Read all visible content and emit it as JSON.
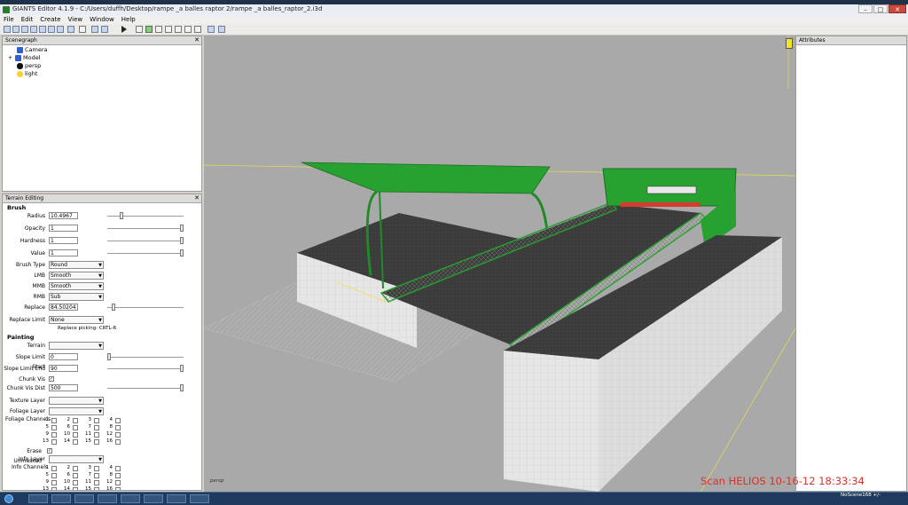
{
  "window": {
    "title": "GIANTS Editor 4.1.9 - C:/Users/duffh/Desktop/rampe _a balles raptor 2/rampe _a balles_raptor_2.i3d",
    "minimize": "–",
    "maximize": "□",
    "close": "✕"
  },
  "menu": [
    "File",
    "Edit",
    "Create",
    "View",
    "Window",
    "Help"
  ],
  "scenegraph": {
    "title": "Scenegraph",
    "close": "✕",
    "items": [
      {
        "label": "Camera",
        "icon": "camera-icon",
        "expand": ""
      },
      {
        "label": "Model",
        "icon": "model-icon",
        "expand": "+"
      },
      {
        "label": "persp",
        "icon": "persp-camera-icon",
        "expand": ""
      },
      {
        "label": "light",
        "icon": "light-bulb-icon",
        "expand": ""
      }
    ]
  },
  "terrain": {
    "title": "Terrain Editing",
    "close": "✕",
    "brush_header": "Brush",
    "radius": {
      "label": "Radius",
      "value": "10.4967",
      "level": 0.17
    },
    "opacity": {
      "label": "Opacity",
      "value": "1",
      "level": 1.0
    },
    "hardness": {
      "label": "Hardness",
      "value": "1",
      "level": 1.0
    },
    "value": {
      "label": "Value",
      "value": "1",
      "level": 1.0
    },
    "brush_type": {
      "label": "Brush Type",
      "value": "Round"
    },
    "lmb": {
      "label": "LMB",
      "value": "Smooth"
    },
    "mmb": {
      "label": "MMB",
      "value": "Smooth"
    },
    "rmb": {
      "label": "RMB",
      "value": "Sub"
    },
    "replace": {
      "label": "Replace",
      "value": "84.50204",
      "level": 0.06
    },
    "replace_limit": {
      "label": "Replace Limit",
      "value": "None"
    },
    "replace_picking": "Replace picking: CRTL-R",
    "painting_header": "Painting",
    "terrain_field": {
      "label": "Terrain",
      "value": ""
    },
    "slope_start": {
      "label": "Slope Limit Start",
      "value": "0",
      "level": 0.0
    },
    "slope_end": {
      "label": "Slope Limit End",
      "value": "90",
      "level": 1.0
    },
    "chunk_vis": {
      "label": "Chunk Vis",
      "check": "✓"
    },
    "chunk_vis_dist": {
      "label": "Chunk Vis Dist",
      "value": "500",
      "level": 1.0
    },
    "texture_layer": {
      "label": "Texture Layer",
      "value": ""
    },
    "foliage_layer": {
      "label": "Foliage Layer",
      "value": ""
    },
    "foliage_channels": {
      "label": "Foliage Channels",
      "numbers": [
        "1",
        "2",
        "3",
        "4",
        "5",
        "6",
        "7",
        "8",
        "9",
        "10",
        "11",
        "12",
        "13",
        "14",
        "15",
        "16"
      ]
    },
    "erase_unmasked": {
      "label": "Erase Unmasked",
      "check": "✓"
    },
    "info_layer": {
      "label": "Info Layer",
      "value": ""
    },
    "info_channels": {
      "label": "Info Channels",
      "numbers": [
        "1",
        "2",
        "3",
        "4",
        "5",
        "6",
        "7",
        "8",
        "9",
        "10",
        "11",
        "12",
        "13",
        "14",
        "15",
        "16"
      ]
    }
  },
  "attributes": {
    "title": "Attributes"
  },
  "viewport": {
    "camera_label": "persp"
  },
  "watermark": "Scan HELIOS 10-16-12 18:33:34",
  "statusbar": {
    "text": "NoScene168 +/-"
  },
  "colors": {
    "ramp_green": "#27a12f",
    "asphalt": "#3b3b3b",
    "wall": "#e8e8e8",
    "viewport_bg": "#a9a9a9",
    "watermark": "#d9312b"
  }
}
